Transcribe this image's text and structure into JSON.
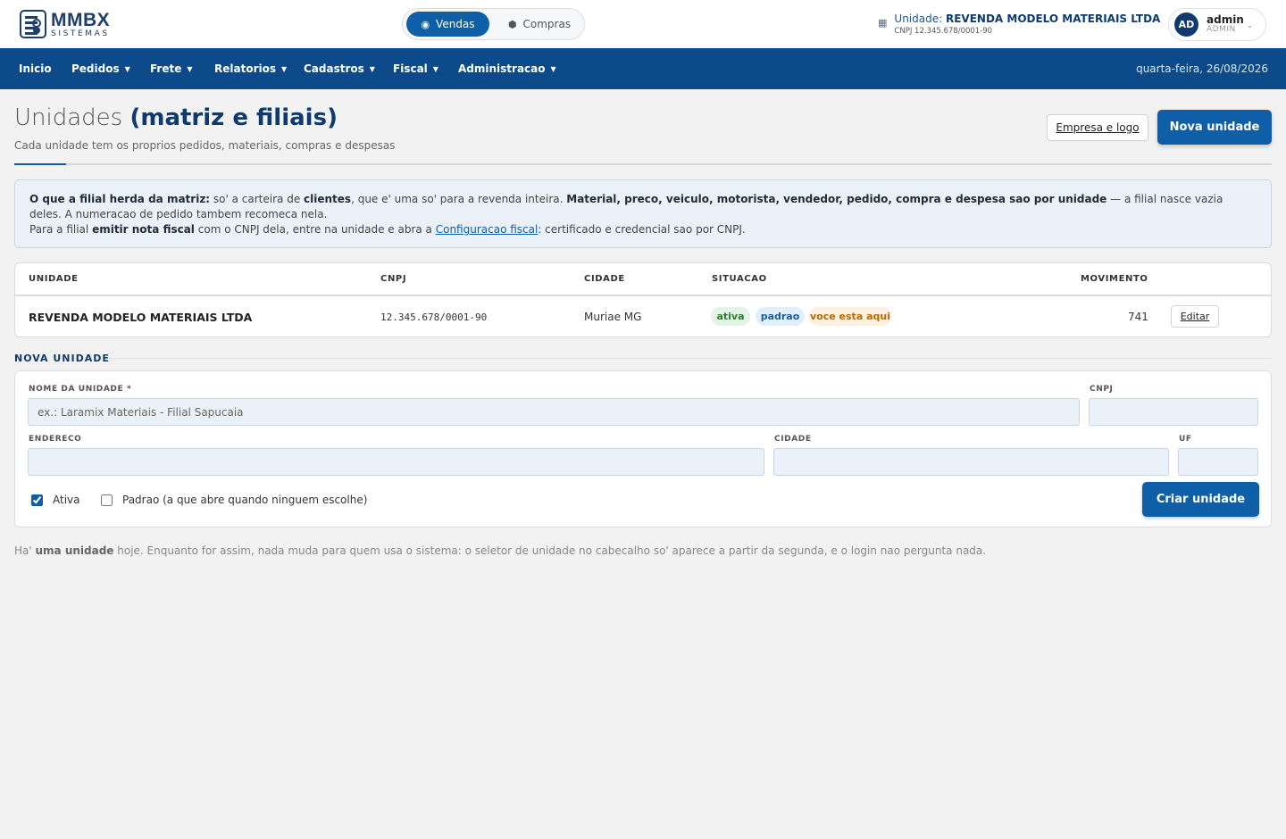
{
  "brand": {
    "title": "MMBX",
    "subtitle": "SISTEMAS"
  },
  "switcher": {
    "active": "Vendas",
    "inactive": "Compras"
  },
  "unit": {
    "label": "Unidade:",
    "name": "REVENDA MODELO MATERIAIS LTDA",
    "cnpj": "CNPJ 12.345.678/0001-90"
  },
  "user": {
    "initials": "AD",
    "name": "admin",
    "role": "ADMIN"
  },
  "nav": {
    "items": [
      "Inicio",
      "Pedidos",
      "Frete",
      "Relatorios",
      "Cadastros",
      "Fiscal",
      "Administracao"
    ],
    "date": "quarta-feira, 26/08/2026"
  },
  "page": {
    "title_light": "Unidades",
    "title_bold": "(matriz e filiais)",
    "subtitle": "Cada unidade tem os proprios pedidos, materiais, compras e despesas",
    "btn_company": "Empresa e logo",
    "btn_new": "Nova unidade"
  },
  "info": {
    "p1": "O que a filial herda da matriz:",
    "p2": " so' a carteira de ",
    "p3": "clientes",
    "p4": ", que e' uma so' para a revenda inteira. ",
    "p5": "Material, preco, veiculo, motorista, vendedor, pedido, compra e despesa sao por unidade",
    "p6": " — a filial nasce vazia deles. A numeracao de pedido tambem recomeca nela.",
    "p7": "Para a filial ",
    "p8": "emitir nota fiscal",
    "p9": " com o CNPJ dela, entre na unidade e abra a ",
    "link": "Configuracao fiscal",
    "p10": ": certificado e credencial sao por CNPJ."
  },
  "table": {
    "headers": {
      "unidade": "UNIDADE",
      "cnpj": "CNPJ",
      "cidade": "CIDADE",
      "situacao": "SITUACAO",
      "movimento": "MOVIMENTO"
    },
    "rows": [
      {
        "unidade": "REVENDA MODELO MATERIAIS LTDA",
        "cnpj": "12.345.678/0001-90",
        "cidade": "Muriae MG",
        "badges": [
          "ativa",
          "padrao",
          "voce esta aqui"
        ],
        "movimento": "741",
        "action": "Editar"
      }
    ]
  },
  "form": {
    "section": "NOVA UNIDADE",
    "nome_label": "NOME DA UNIDADE *",
    "nome_placeholder": "ex.: Laramix Materiais - Filial Sapucaia",
    "cnpj_label": "CNPJ",
    "endereco_label": "ENDERECO",
    "cidade_label": "CIDADE",
    "uf_label": "UF",
    "ativa_label": "Ativa",
    "padrao_label": "Padrao (a que abre quando ninguem escolhe)",
    "submit": "Criar unidade"
  },
  "footer": {
    "a": "Ha' ",
    "b": "uma unidade",
    "c": " hoje. Enquanto for assim, nada muda para quem usa o sistema: o seletor de unidade no cabecalho so' aparece a partir da segunda, e o login nao pergunta nada."
  }
}
